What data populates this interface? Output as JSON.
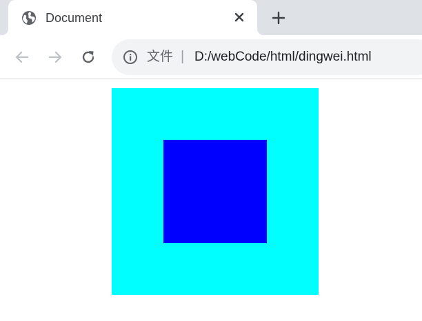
{
  "tab": {
    "title": "Document",
    "favicon": "globe-icon",
    "close_icon": "close-icon"
  },
  "new_tab_icon": "plus-icon",
  "toolbar": {
    "back_icon": "arrow-left-icon",
    "forward_icon": "arrow-right-icon",
    "reload_icon": "reload-icon",
    "back_enabled": false,
    "forward_enabled": false
  },
  "omnibox": {
    "info_icon": "info-icon",
    "security_label": "文件",
    "separator": "|",
    "url": "D:/webCode/html/dingwei.html"
  },
  "page": {
    "outer_box_color": "#00ffff",
    "inner_box_color": "#0000ff"
  },
  "colors": {
    "tab_strip": "#dee1e6",
    "omnibox_bg": "#f1f3f4",
    "icon_gray": "#5f6368",
    "disabled_gray": "#bdc1c6"
  }
}
